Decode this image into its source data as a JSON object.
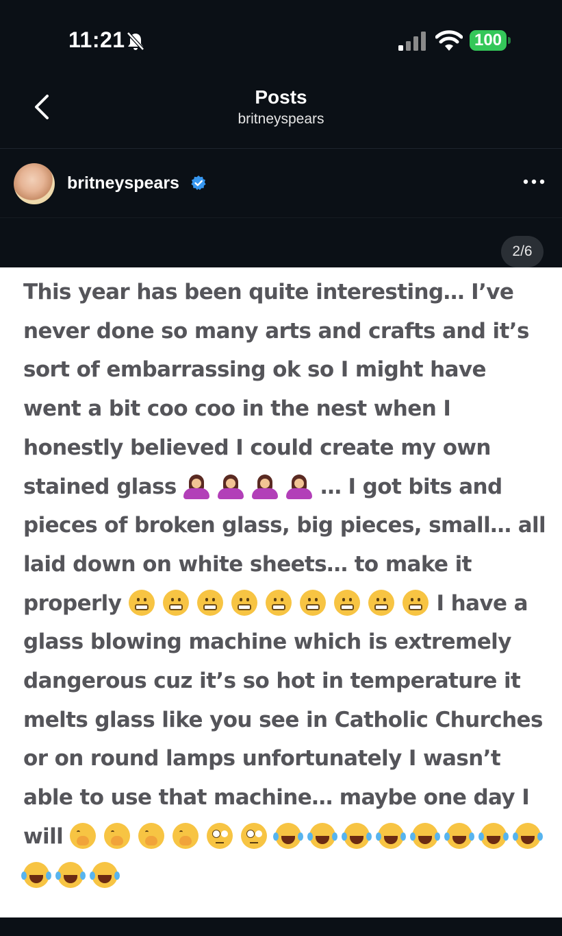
{
  "status_bar": {
    "time": "11:21",
    "battery": "100",
    "icons": [
      "bell-slash-icon",
      "cellular-signal-icon",
      "wifi-icon",
      "battery-icon"
    ]
  },
  "nav": {
    "title": "Posts",
    "subtitle": "britneyspears",
    "back_icon": "chevron-left-icon"
  },
  "post": {
    "username": "britneyspears",
    "verified_icon": "verified-badge-icon",
    "more_icon": "more-horizontal-icon",
    "page_counter": "2/6",
    "text_segments": {
      "s1": "This year has been quite interesting… I’ve never done so many arts and crafts and it’s sort of embarrassing ok so I might have went a bit coo coo in the nest when I honestly believed I could create my own stained glass ",
      "s2": "… I got bits and pieces of broken glass, big pieces, small… all laid down on white sheets… to make it properly ",
      "s3": "I have a glass blowing machine which is extremely dangerous cuz it’s so hot in temperature it melts glass like you see in Catholic Churches or on round lamps unfortunately I wasn’t able to use that machine… maybe one day I will "
    },
    "emoji": {
      "shrug_count": 4,
      "grimace_count": 9,
      "hand_over_mouth_count": 4,
      "eye_roll_count": 2,
      "tears_of_joy_count": 11
    }
  },
  "colors": {
    "background": "#0b1016",
    "post_text": "#55555a",
    "battery": "#34c759",
    "verified": "#3797f0"
  }
}
